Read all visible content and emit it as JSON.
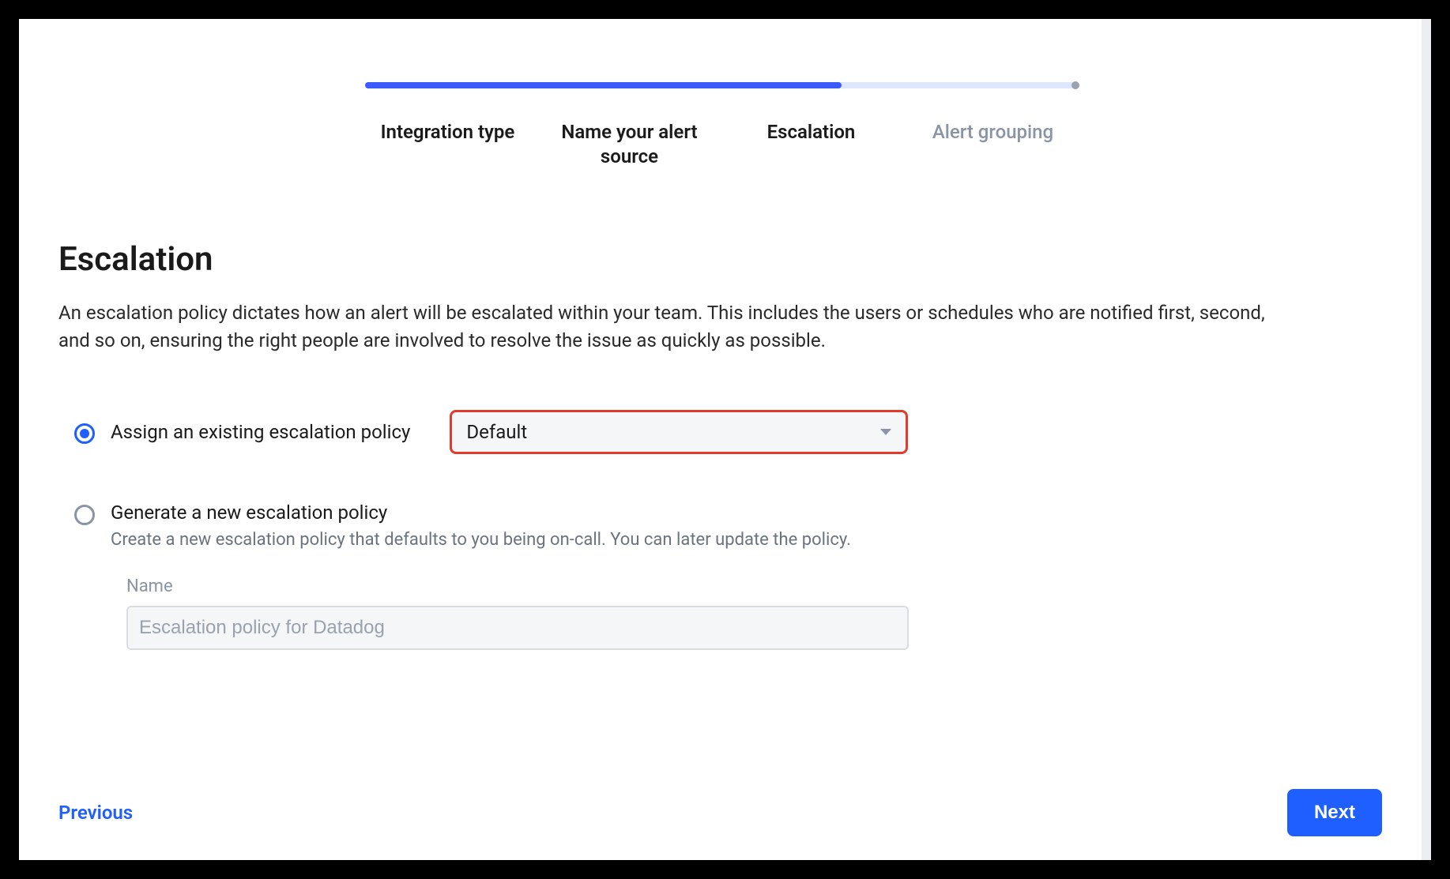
{
  "stepper": {
    "steps": [
      {
        "label": "Integration type",
        "active": true
      },
      {
        "label": "Name your alert source",
        "active": true
      },
      {
        "label": "Escalation",
        "active": true
      },
      {
        "label": "Alert grouping",
        "active": false
      }
    ],
    "progress_percent": 67
  },
  "page": {
    "title": "Escalation",
    "description": "An escalation policy dictates how an alert will be escalated within your team. This includes the users or schedules who are notified first, second, and so on, ensuring the right people are involved to resolve the issue as quickly as possible."
  },
  "options": {
    "assign_existing": {
      "label": "Assign an existing escalation policy",
      "selected": true,
      "select_value": "Default"
    },
    "generate_new": {
      "label": "Generate a new escalation policy",
      "sub": "Create a new escalation policy that defaults to you being on-call. You can later update the policy.",
      "selected": false,
      "name_label": "Name",
      "name_placeholder": "Escalation policy for Datadog",
      "name_value": ""
    }
  },
  "footer": {
    "previous": "Previous",
    "next": "Next"
  }
}
